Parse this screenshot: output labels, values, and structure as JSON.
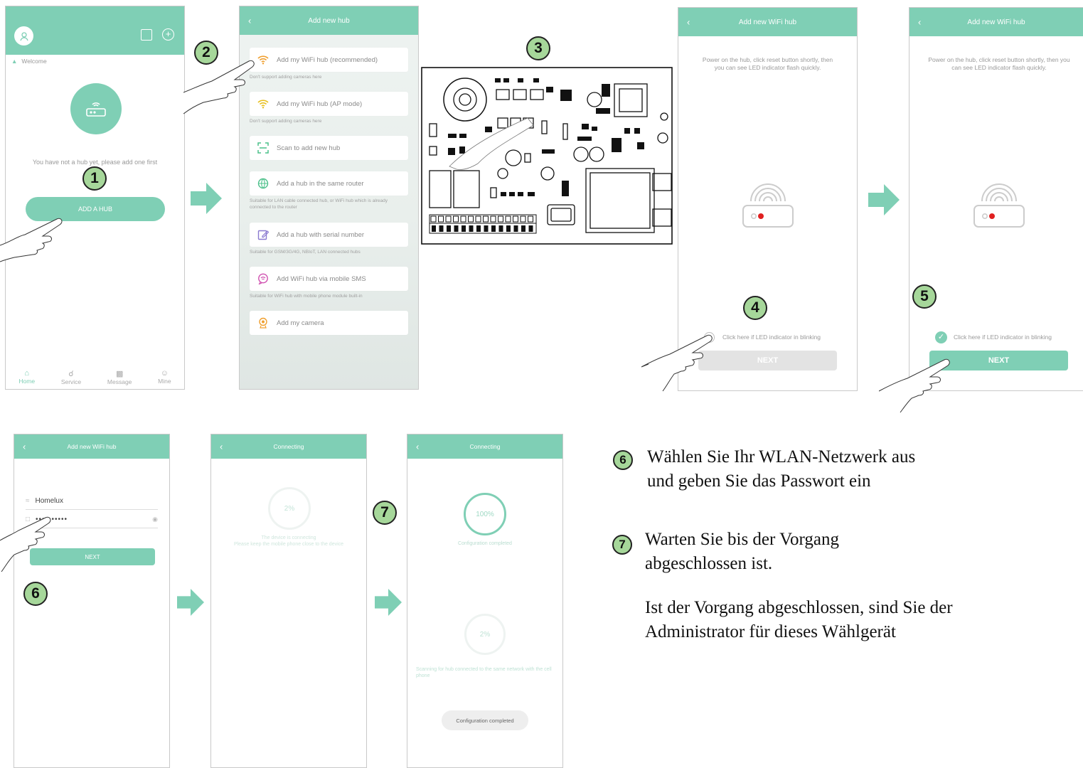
{
  "screen1": {
    "welcome": "Welcome",
    "no_hub_text": "You have not a hub yet, please add one first",
    "add_hub_button": "ADD A HUB",
    "nav": [
      {
        "label": "Home",
        "icon": "home-icon"
      },
      {
        "label": "Service",
        "icon": "headset-icon"
      },
      {
        "label": "Message",
        "icon": "message-icon"
      },
      {
        "label": "Mine",
        "icon": "user-icon"
      }
    ]
  },
  "screen2": {
    "title": "Add new hub",
    "items": [
      {
        "label": "Add my WiFi hub (recommended)",
        "sub": "Don't support adding cameras here",
        "icon": "wifi-icon",
        "color": "#f0a030"
      },
      {
        "label": "Add my WiFi hub (AP mode)",
        "sub": "Don't support adding cameras here",
        "icon": "wifi-icon",
        "color": "#e8c020"
      },
      {
        "label": "Scan to add new hub",
        "sub": "",
        "icon": "scan-icon",
        "color": "#4cc08a"
      },
      {
        "label": "Add a hub in the same router",
        "sub": "Suitable for LAN cable connected hub, or WiFi hub which is already connected to the router",
        "icon": "globe-icon",
        "color": "#4cc08a"
      },
      {
        "label": "Add a hub with serial number",
        "sub": "Suitable for GSM/3G/4G, NBIoT, LAN connected hubs",
        "icon": "edit-icon",
        "color": "#8a7ad0"
      },
      {
        "label": "Add WiFi hub via mobile SMS",
        "sub": "Suitable for WiFi hub with mobile phone module built-in",
        "icon": "sms-icon",
        "color": "#d050b0"
      },
      {
        "label": "Add my camera",
        "sub": "",
        "icon": "camera-icon",
        "color": "#f0a030"
      }
    ]
  },
  "screen4": {
    "title": "Add new WiFi hub",
    "instruction": "Power on the hub, click reset button shortly, then you can see LED indicator flash quickly.",
    "checkbox_label": "Click here if LED indicator in blinking",
    "next_button": "NEXT"
  },
  "screen5": {
    "title": "Add new WiFi hub",
    "instruction": "Power on the hub, click reset button shortly, then you can see LED indicator flash quickly.",
    "checkbox_label": "Click here if LED indicator in blinking",
    "next_button": "NEXT"
  },
  "screen6": {
    "title": "Add new WiFi hub",
    "ssid": "Homelux",
    "password": "••••••••••",
    "next_button": "NEXT"
  },
  "screen7": {
    "title": "Connecting",
    "progress": "2%",
    "status": "The device is connecting",
    "hint": "Please keep the mobile phone close to the device"
  },
  "screen8": {
    "title": "Connecting",
    "progress_top": "100%",
    "status_top": "Configuration completed",
    "progress_bottom": "2%",
    "scan_text": "Scanning for hub connected to the same network with the cell phone",
    "config_button": "Configuration completed"
  },
  "badges": {
    "b1": "1",
    "b2": "2",
    "b3": "3",
    "b4": "4",
    "b5": "5",
    "b6": "6",
    "b7": "7"
  },
  "instructions": {
    "step6_badge": "6",
    "step6_text": "Wählen Sie Ihr WLAN-Netzwerk aus und geben Sie das Passwort ein",
    "step7_badge": "7",
    "step7_text": "Warten Sie bis der Vorgang abgeschlossen ist.",
    "final_text": "Ist der Vorgang abgeschlossen, sind Sie der Administrator für dieses Wählgerät"
  },
  "colors": {
    "accent": "#7fcfb5",
    "badge": "#a6d79a",
    "red_led": "#e02020"
  }
}
